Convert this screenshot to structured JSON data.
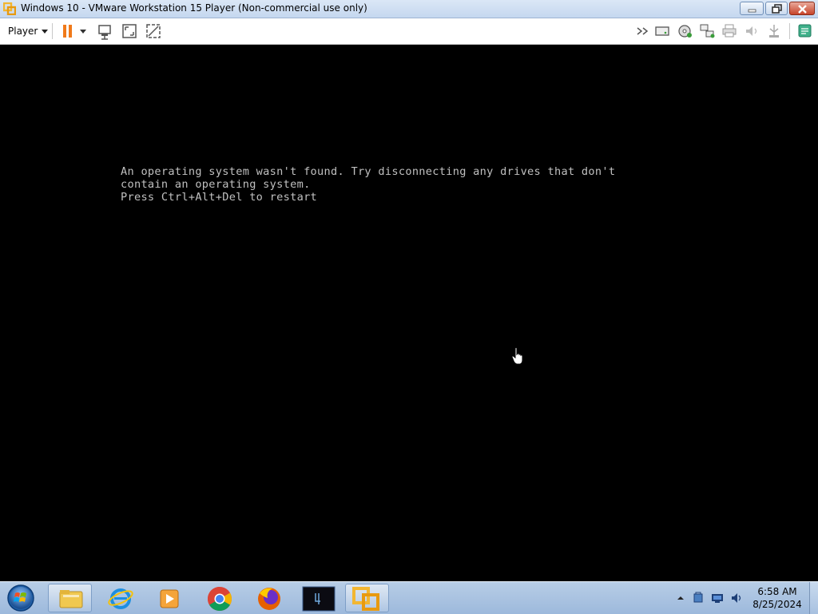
{
  "window": {
    "title": "Windows 10 - VMware Workstation 15 Player (Non-commercial use only)"
  },
  "toolbar": {
    "player_label": "Player"
  },
  "console": {
    "line1": "An operating system wasn't found. Try disconnecting any drives that don't",
    "line2": "contain an operating system.",
    "line3": "Press Ctrl+Alt+Del to restart"
  },
  "taskbar": {
    "apps": [
      "Windows Explorer",
      "Internet Explorer",
      "Windows Media Player",
      "Google Chrome",
      "Firefox",
      "Terminal",
      "VMware Player"
    ],
    "clock_time": "6:58 AM",
    "clock_date": "8/25/2024"
  },
  "colors": {
    "console_text": "#c0c0c0",
    "pause_orange": "#f07a1a",
    "vmware_yellow": "#f2b632"
  }
}
